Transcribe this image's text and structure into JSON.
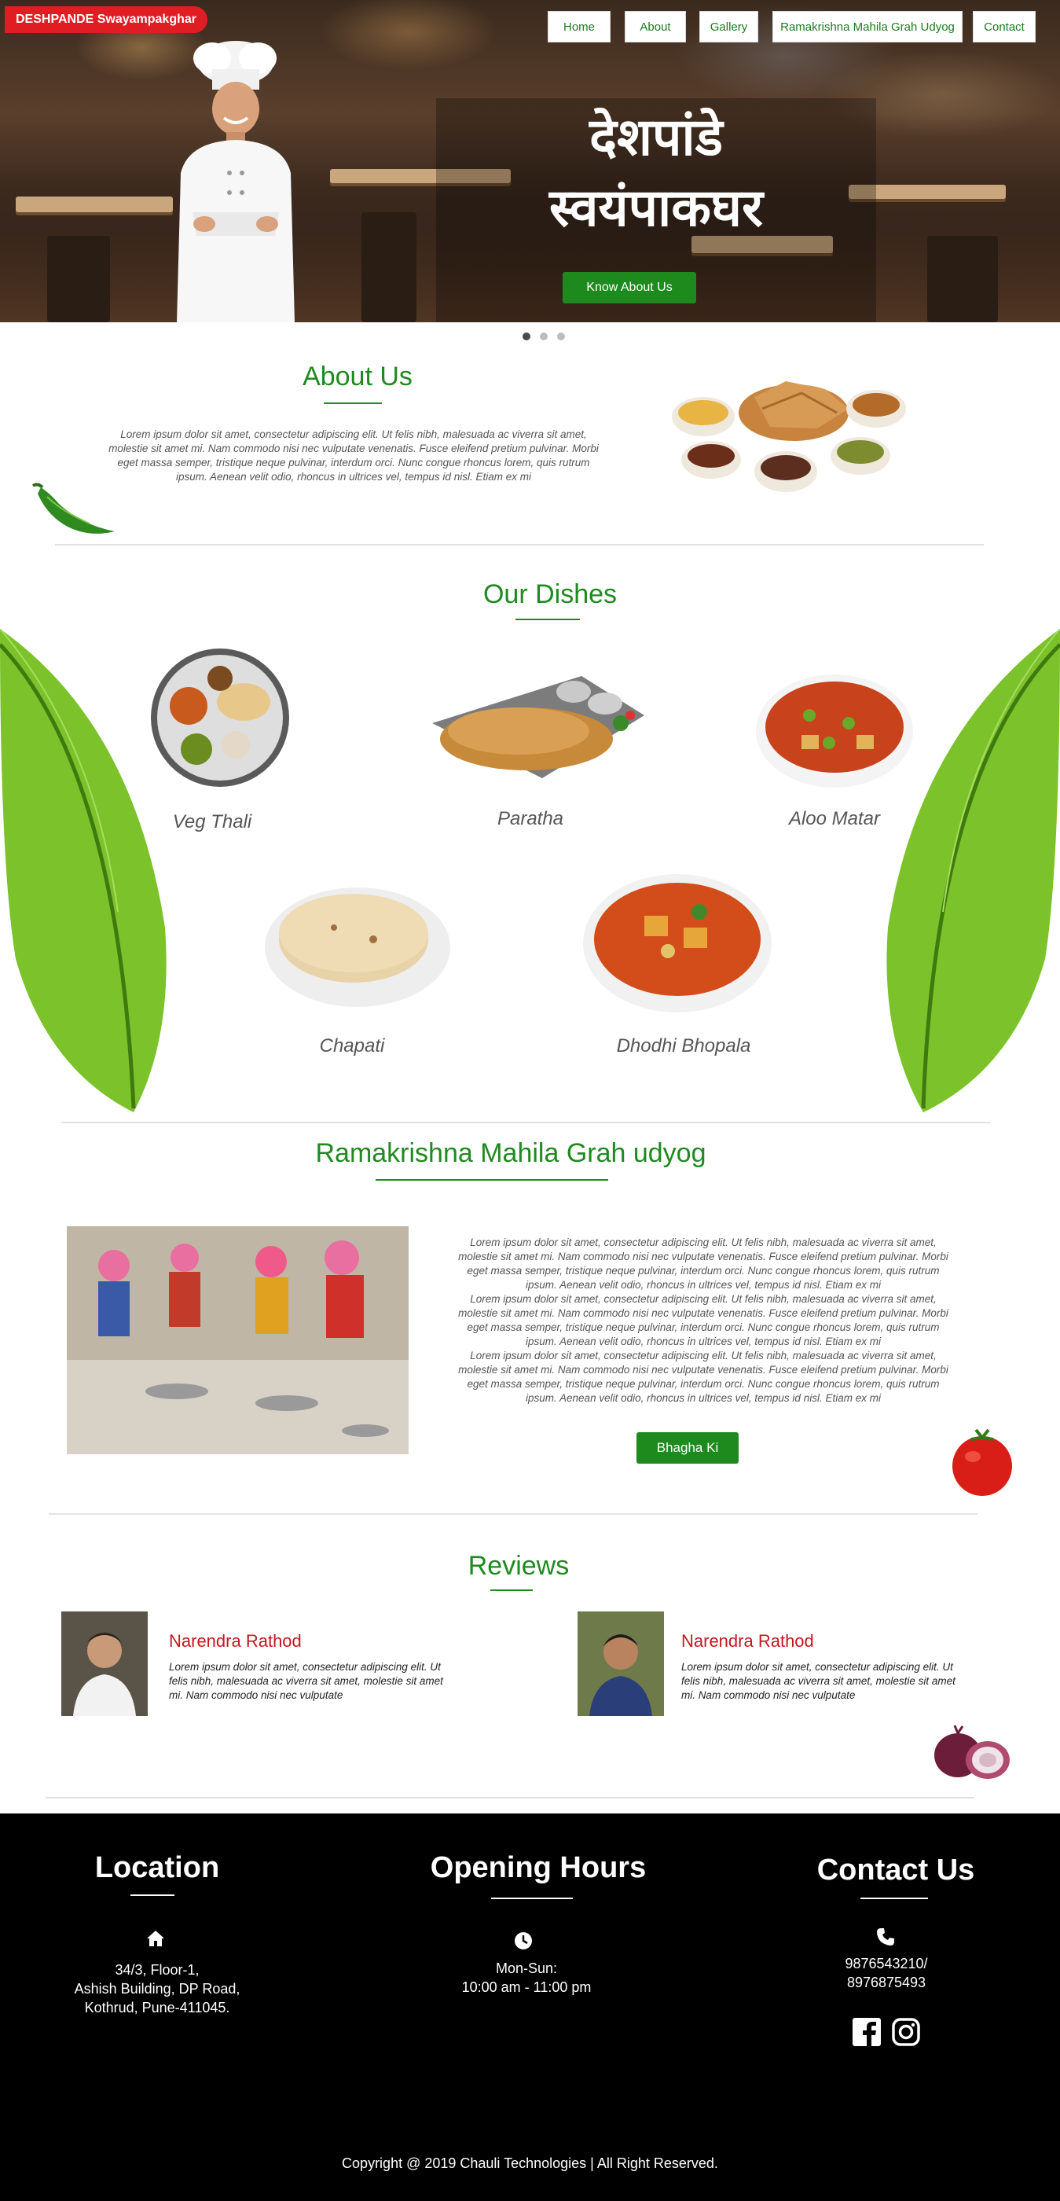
{
  "brand": "DESHPANDE Swayampakghar",
  "nav": [
    "Home",
    "About",
    "Gallery",
    "Ramakrishna Mahila Grah Udyog",
    "Contact"
  ],
  "hero": {
    "title_line1": "देशपांडे",
    "title_line2": "स्वयंपाकघर",
    "button": "Know About Us"
  },
  "about": {
    "title": "About Us",
    "text": "Lorem ipsum dolor sit amet, consectetur adipiscing elit. Ut felis nibh, malesuada ac viverra sit amet, molestie sit amet mi. Nam commodo nisi nec vulputate venenatis. Fusce eleifend pretium pulvinar. Morbi eget massa semper, tristique neque pulvinar, interdum orci. Nunc congue rhoncus lorem, quis rutrum ipsum. Aenean velit odio, rhoncus in ultrices vel, tempus id nisl. Etiam ex mi"
  },
  "dishes": {
    "title": "Our Dishes",
    "items": [
      "Veg Thali",
      "Paratha",
      "Aloo Matar",
      "Chapati",
      "Dhodhi Bhopala"
    ]
  },
  "udyog": {
    "title": "Ramakrishna Mahila Grah udyog",
    "paragraph": "Lorem ipsum dolor sit amet, consectetur adipiscing elit. Ut felis nibh, malesuada ac viverra sit amet, molestie sit amet mi. Nam commodo nisi nec vulputate venenatis. Fusce eleifend pretium pulvinar. Morbi eget massa semper, tristique neque pulvinar, interdum orci. Nunc congue rhoncus lorem, quis rutrum ipsum. Aenean velit odio, rhoncus in ultrices vel, tempus id nisl. Etiam ex mi",
    "button": "Bhagha Ki"
  },
  "reviews": {
    "title": "Reviews",
    "items": [
      {
        "name": "Narendra Rathod",
        "text": "Lorem ipsum dolor sit amet, consectetur adipiscing elit. Ut felis nibh, malesuada ac viverra sit amet, molestie sit amet mi. Nam commodo nisi nec vulputate"
      },
      {
        "name": "Narendra Rathod",
        "text": "Lorem ipsum dolor sit amet, consectetur adipiscing elit. Ut felis nibh, malesuada ac viverra sit amet, molestie sit amet mi. Nam commodo nisi nec vulputate"
      }
    ]
  },
  "footer": {
    "location": {
      "title": "Location",
      "line1": "34/3, Floor-1,",
      "line2": "Ashish Building, DP Road,",
      "line3": "Kothrud, Pune-411045.",
      "icon": "home-icon"
    },
    "hours": {
      "title": "Opening Hours",
      "line1": "Mon-Sun:",
      "line2": "10:00 am - 11:00 pm",
      "icon": "clock-icon"
    },
    "contact": {
      "title": "Contact Us",
      "line1": "9876543210/",
      "line2": "8976875493",
      "icon": "phone-icon"
    },
    "copyright": "Copyright @ 2019 Chauli Technologies | All Right Reserved."
  },
  "colors": {
    "green": "#1f8a1f",
    "red": "#e11d24",
    "review_red": "#c7161e"
  }
}
